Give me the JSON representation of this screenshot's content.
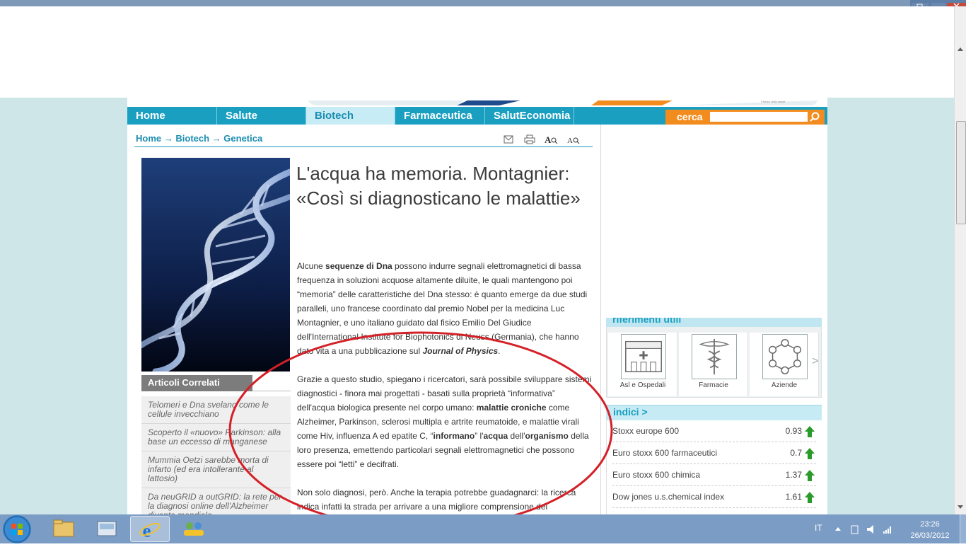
{
  "nav": {
    "items": [
      "Home",
      "Salute",
      "Biotech",
      "Farmaceutica",
      "SalutEconomia"
    ],
    "active": "Biotech",
    "search_label": "cerca",
    "search_value": ""
  },
  "breadcrumb": {
    "home": "Home",
    "section": "Biotech",
    "subsection": "Genetica",
    "separator": "→"
  },
  "article": {
    "title": "L'acqua ha memoria. Montagnier: «Così si diagnosticano le malattie»",
    "p1": [
      {
        "t": "Alcune "
      },
      {
        "t": "sequenze di Dna",
        "b": true
      },
      {
        "t": " possono indurre segnali elettromagnetici di bassa frequenza in soluzioni acquose altamente diluite, le quali mantengono poi “memoria” delle caratteristiche del Dna stesso: è quanto emerge da due studi paralleli, uno francese coordinato dal premio Nobel per la medicina Luc Montagnier, e uno italiano guidato dal fisico Emilio Del Giudice dell'International Institute for Biophotonics di Neuss (Germania), che hanno dato vita a una pubblicazione sul "
      },
      {
        "t": "Journal of Physics",
        "b": true,
        "i": true
      },
      {
        "t": "."
      }
    ],
    "p2": [
      {
        "t": "Grazie a questo studio, spiegano i ricercatori, sarà possibile sviluppare sistemi diagnostici - finora mai progettati - basati sulla proprietà “informativa” dell'acqua biologica presente nel corpo umano: "
      },
      {
        "t": "malattie croniche",
        "b": true
      },
      {
        "t": " come Alzheimer, Parkinson, sclerosi multipla e artrite reumatoide, e malattie virali come Hiv, influenza A ed epatite C, “"
      },
      {
        "t": "informano",
        "b": true
      },
      {
        "t": "” l'"
      },
      {
        "t": "acqua",
        "b": true
      },
      {
        "t": " dell'"
      },
      {
        "t": "organismo",
        "b": true
      },
      {
        "t": " della loro presenza, emettendo particolari segnali elettromagnetici che possono essere poi “letti” e decifrati."
      }
    ],
    "p3": [
      {
        "t": "Non solo diagnosi, però. Anche la terapia potrebbe guadagnarci: la ricerca indica infatti la strada per arrivare a una migliore comprensione dei"
      }
    ]
  },
  "correlati": {
    "heading": "Articoli Correlati",
    "items": [
      "Telomeri e Dna svelano come le cellule invecchiano",
      "Scoperto il «nuovo» Parkinson: alla base un eccesso di manganese",
      "Mummia Oetzi sarebbe morta di infarto (ed era intollerante al lattosio)",
      "Da neuGRID a outGRID: la rete per la diagnosi online dell'Alzheimer diventa mondiale"
    ]
  },
  "riferimenti": {
    "title": "riferimenti utili",
    "cards": [
      {
        "label": "Asl e Ospedali",
        "icon": "hospital-icon"
      },
      {
        "label": "Farmacie",
        "icon": "caduceus-icon"
      },
      {
        "label": "Aziende",
        "icon": "molecule-icon"
      }
    ],
    "next": ">"
  },
  "indici": {
    "title": "indici >",
    "rows": [
      {
        "name": "Stoxx europe 600",
        "value": "0.93"
      },
      {
        "name": "Euro stoxx 600 farmaceutici",
        "value": "0.7"
      },
      {
        "name": "Euro stoxx 600 chimica",
        "value": "1.37"
      },
      {
        "name": "Dow jones u.s.chemical index",
        "value": "1.61"
      }
    ],
    "up_color": "#2a9a2a"
  },
  "annotation": {
    "color": "#d42027"
  },
  "taskbar": {
    "apps": [
      "start-button",
      "explorer-icon",
      "library-icon",
      "internet-explorer-icon",
      "network-app-icon"
    ],
    "lang": "IT",
    "time": "23:26",
    "date": "26/03/2012"
  }
}
